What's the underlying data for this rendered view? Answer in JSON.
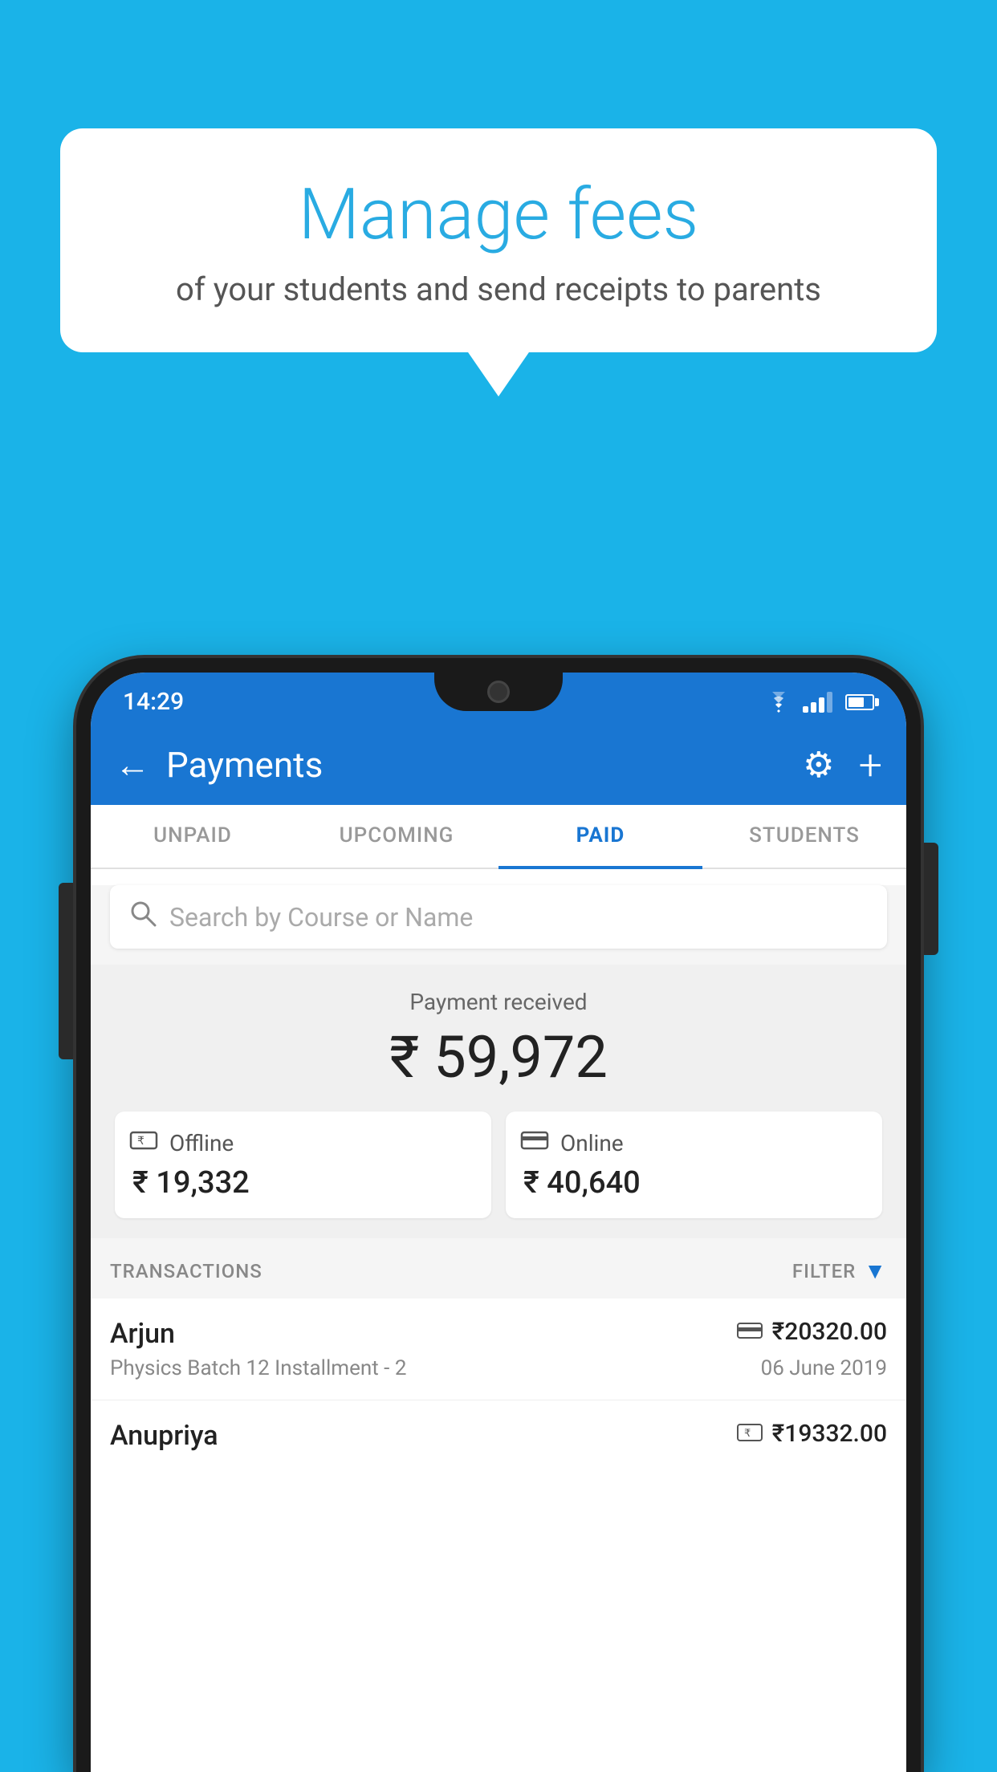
{
  "background_color": "#1ab3e8",
  "bubble": {
    "title": "Manage fees",
    "subtitle": "of your students and send receipts to parents"
  },
  "status_bar": {
    "time": "14:29",
    "wifi": "▼",
    "battery_level": 60
  },
  "header": {
    "title": "Payments",
    "back_label": "←",
    "settings_label": "⚙",
    "add_label": "+"
  },
  "tabs": [
    {
      "id": "unpaid",
      "label": "UNPAID",
      "active": false
    },
    {
      "id": "upcoming",
      "label": "UPCOMING",
      "active": false
    },
    {
      "id": "paid",
      "label": "PAID",
      "active": true
    },
    {
      "id": "students",
      "label": "STUDENTS",
      "active": false
    }
  ],
  "search": {
    "placeholder": "Search by Course or Name"
  },
  "payment_summary": {
    "label": "Payment received",
    "amount": "₹ 59,972",
    "cards": [
      {
        "id": "offline",
        "icon": "🧾",
        "type": "Offline",
        "amount": "₹ 19,332"
      },
      {
        "id": "online",
        "icon": "💳",
        "type": "Online",
        "amount": "₹ 40,640"
      }
    ]
  },
  "transactions": {
    "header_label": "TRANSACTIONS",
    "filter_label": "FILTER",
    "rows": [
      {
        "student": "Arjun",
        "course": "Physics Batch 12 Installment - 2",
        "amount": "₹20320.00",
        "date": "06 June 2019",
        "payment_type": "online"
      },
      {
        "student": "Anupriya",
        "course": "",
        "amount": "₹19332.00",
        "date": "",
        "payment_type": "offline"
      }
    ]
  }
}
